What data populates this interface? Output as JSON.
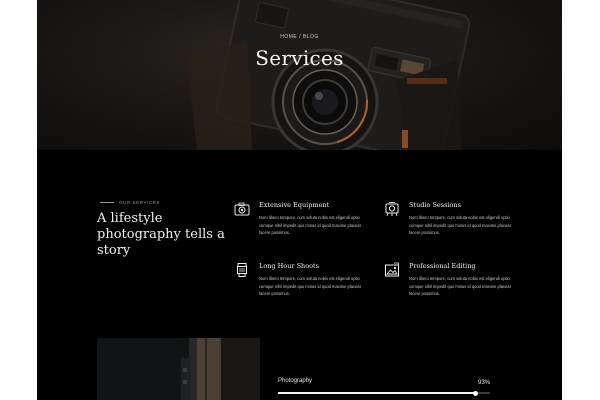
{
  "hero": {
    "breadcrumb": "HOME / BLOG",
    "title": "Services"
  },
  "intro": {
    "eyebrow": "OUR SERVICES",
    "tagline": "A lifestyle photography tells a story"
  },
  "services": [
    {
      "title": "Extensive Equipment",
      "icon": "camera-icon",
      "description": "Nom libero tempore, cum soluta nobis est eligendi optio cumque nihil impedit quo minus id quod maxime placeat facere possimus."
    },
    {
      "title": "Studio Sessions",
      "icon": "studio-icon",
      "description": "Nom libero tempore, cum soluta nobis est eligendi optio cumque nihil impedit quo minus id quod maxime placeat facere possimus."
    },
    {
      "title": "Long Hour Shoots",
      "icon": "lens-icon",
      "description": "Nom libero tempore, cum soluta nobis est eligendi optio cumque nihil impedit quo minus id quod maxime placeat facere possimus."
    },
    {
      "title": "Professional Editing",
      "icon": "photo-edit-icon",
      "description": "Nom libero tempore, cum soluta nobis est eligendi optio cumque nihil impedit quo minus id quod maxime placeat facere possimus."
    }
  ],
  "skills": [
    {
      "label": "Photography",
      "percent_text": "93%",
      "level": 0.93
    }
  ],
  "colors": {
    "background": "#000000",
    "text": "#f2f2f2",
    "muted": "#c8c8c8"
  }
}
